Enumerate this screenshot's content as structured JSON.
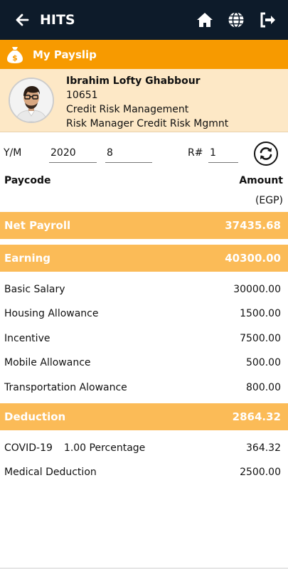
{
  "app": {
    "title": "HITS"
  },
  "section": {
    "title": "My Payslip"
  },
  "employee": {
    "name": "Ibrahim Lofty Ghabbour",
    "id": "10651",
    "department": "Credit Risk Management",
    "position": "Risk Manager Credit Risk Mgmnt"
  },
  "filter": {
    "ym_label": "Y/M",
    "year": "2020",
    "month": "8",
    "run_label": "R#",
    "run": "1"
  },
  "columns": {
    "paycode": "Paycode",
    "amount": "Amount",
    "currency": "(EGP)"
  },
  "net_payroll": {
    "label": "Net Payroll",
    "amount": "37435.68"
  },
  "earning": {
    "label": "Earning",
    "amount": "40300.00",
    "items": [
      {
        "label": "Basic Salary",
        "amount": "30000.00"
      },
      {
        "label": "Housing Allowance",
        "amount": "1500.00"
      },
      {
        "label": "Incentive",
        "amount": "7500.00"
      },
      {
        "label": "Mobile Allowance",
        "amount": "500.00"
      },
      {
        "label": "Transportation Alowance",
        "amount": "800.00"
      }
    ]
  },
  "deduction": {
    "label": "Deduction",
    "amount": "2864.32",
    "items": [
      {
        "label": "COVID-19",
        "detail": "1.00 Percentage",
        "amount": "364.32"
      },
      {
        "label": "Medical Deduction",
        "amount": "2500.00"
      }
    ]
  },
  "icons": {
    "back": "arrow-left-icon",
    "home": "home-icon",
    "language": "globe-icon",
    "logout": "logout-icon",
    "section": "money-bag-icon",
    "refresh": "refresh-icon"
  },
  "colors": {
    "topbar": "#0d1b2a",
    "accent": "#f79a00",
    "band": "#fbbb57",
    "profile_bg": "#fde8c6"
  }
}
